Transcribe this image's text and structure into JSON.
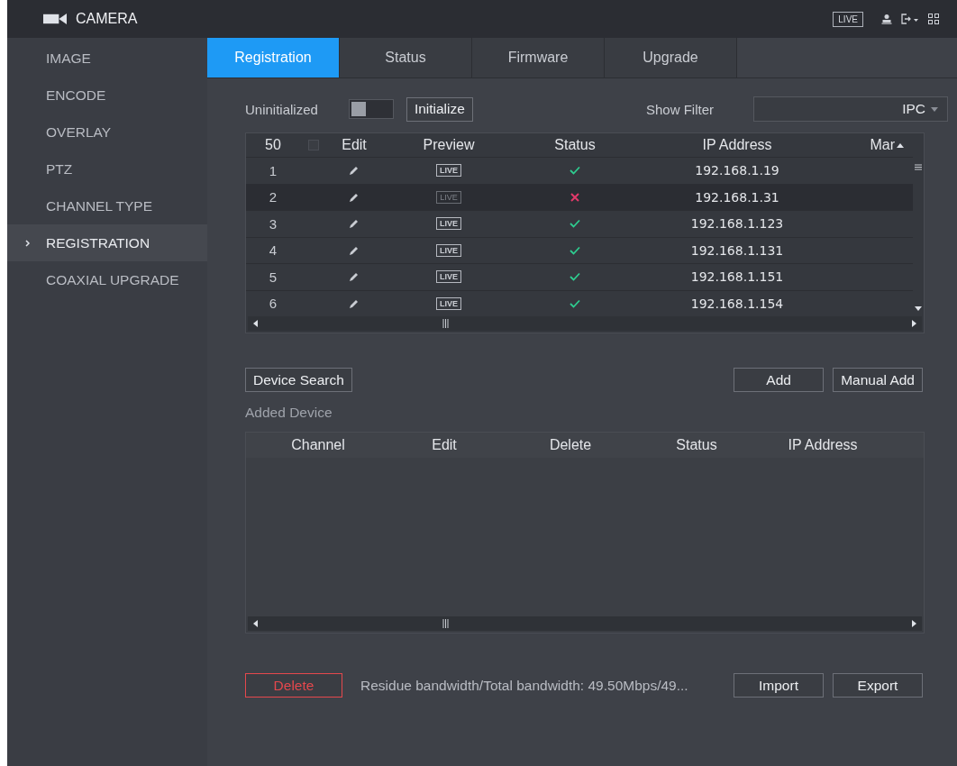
{
  "header": {
    "title": "CAMERA",
    "live_label": "LIVE"
  },
  "sidebar": {
    "items": [
      {
        "label": "IMAGE",
        "selected": false
      },
      {
        "label": "ENCODE",
        "selected": false
      },
      {
        "label": "OVERLAY",
        "selected": false
      },
      {
        "label": "PTZ",
        "selected": false
      },
      {
        "label": "CHANNEL TYPE",
        "selected": false
      },
      {
        "label": "REGISTRATION",
        "selected": true
      },
      {
        "label": "COAXIAL UPGRADE",
        "selected": false
      }
    ]
  },
  "tabs": [
    {
      "label": "Registration",
      "selected": true
    },
    {
      "label": "Status",
      "selected": false
    },
    {
      "label": "Firmware",
      "selected": false
    },
    {
      "label": "Upgrade",
      "selected": false
    }
  ],
  "init_bar": {
    "label": "Uninitialized",
    "toggle_on": false,
    "button": "Initialize",
    "filter_label": "Show Filter",
    "filter_value": "IPC"
  },
  "device_table": {
    "columns": [
      "50",
      "Edit",
      "Preview",
      "Status",
      "IP Address",
      "Mar"
    ],
    "header_checked": false,
    "rows": [
      {
        "no": "1",
        "preview": "LIVE",
        "preview_available": true,
        "online": true,
        "ip": "192.168.1.19"
      },
      {
        "no": "2",
        "preview": "LIVE",
        "preview_available": false,
        "online": false,
        "ip": "192.168.1.31"
      },
      {
        "no": "3",
        "preview": "LIVE",
        "preview_available": true,
        "online": true,
        "ip": "192.168.1.123"
      },
      {
        "no": "4",
        "preview": "LIVE",
        "preview_available": true,
        "online": true,
        "ip": "192.168.1.131"
      },
      {
        "no": "5",
        "preview": "LIVE",
        "preview_available": true,
        "online": true,
        "ip": "192.168.1.151"
      },
      {
        "no": "6",
        "preview": "LIVE",
        "preview_available": true,
        "online": true,
        "ip": "192.168.1.154"
      }
    ]
  },
  "search_bar": {
    "device_search": "Device Search",
    "add": "Add",
    "manual_add": "Manual Add"
  },
  "added_device": {
    "title": "Added Device",
    "columns": [
      "Channel",
      "Edit",
      "Delete",
      "Status",
      "IP Address"
    ]
  },
  "footer": {
    "delete": "Delete",
    "bandwidth": "Residue bandwidth/Total bandwidth:  49.50Mbps/49...",
    "import": "Import",
    "export": "Export"
  }
}
